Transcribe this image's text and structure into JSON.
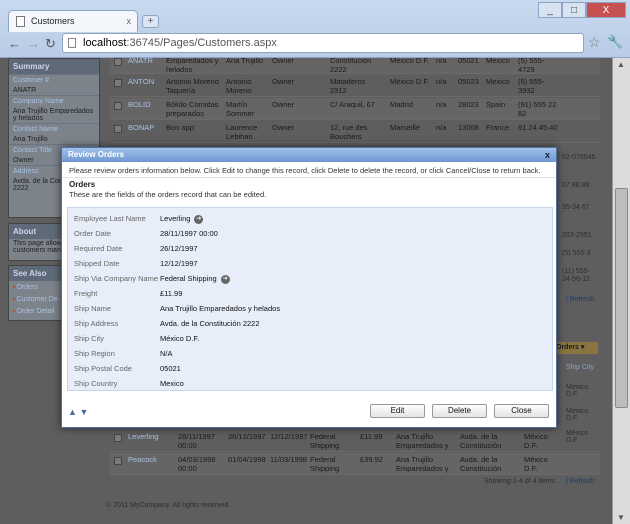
{
  "browser": {
    "tab_title": "Customers",
    "tab_close": "x",
    "new_tab": "+",
    "url_host": "localhost",
    "url_rest": ":36745/Pages/Customers.aspx",
    "win_min": "_",
    "win_max": "□",
    "win_close": "X"
  },
  "sidebar": {
    "summary_header": "Summary",
    "fields": [
      {
        "label": "Customer #",
        "value": "ANATR"
      },
      {
        "label": "Company Name",
        "value": "Ana Trujillo Emparedados y helados"
      },
      {
        "label": "Contact Name",
        "value": "Ana Trujillo"
      },
      {
        "label": "Contact Title",
        "value": "Owner"
      },
      {
        "label": "Address",
        "value": "Avda. de la Constitución 2222"
      }
    ],
    "about_header": "About",
    "about_text": "This page allows customers man",
    "see_also_header": "See Also",
    "links": [
      "Orders",
      "Customer De",
      "Order Detail"
    ]
  },
  "grid_rows": [
    [
      "ANATR",
      "Emparedados y helados",
      "Ana Trujillo",
      "Owner",
      "Constitución 2222",
      "México D.F.",
      "n/a",
      "05021",
      "Mexico",
      "(5) 555-4729"
    ],
    [
      "ANTON",
      "Antonio Moreno Taquería",
      "Antonio Moreno",
      "Owner",
      "Mataderos 2312",
      "México D.F.",
      "n/a",
      "05023",
      "Mexico",
      "(5) 555-3932"
    ],
    [
      "BOLID",
      "Bólido Comidas preparadas",
      "Martín Sommer",
      "Owner",
      "C/ Araquil, 67",
      "Madrid",
      "n/a",
      "28023",
      "Spain",
      "(91) 555 22 82"
    ],
    [
      "BONAP",
      "Bon app'",
      "Laurence Lebihan",
      "Owner",
      "12, rue des Bouchers",
      "Marseille",
      "n/a",
      "13008",
      "France",
      "91.24.45.40"
    ]
  ],
  "right_fragments": [
    "52-076545",
    "67.88.88",
    "95-34 67",
    "283-2951",
    "(5) 555-3",
    "(11) 555-",
    "34-56-12",
    "| Refresh"
  ],
  "orders_grid": {
    "orders_tab": "Orders",
    "ship_city_header": "Ship City",
    "right_cities": [
      "México D.F.",
      "México D.F.",
      "México D.F."
    ],
    "rows": [
      [
        "Leverling",
        "28/11/1997 00:00",
        "26/12/1997",
        "12/12/1997",
        "Federal Shipping",
        "£11.99",
        "Ana Trujillo Emparedados y helados",
        "Avda. de la Constitución 2222",
        "México D.F."
      ],
      [
        "Peacock",
        "04/03/1998 00:00",
        "01/04/1998",
        "11/03/1998",
        "Federal Shipping",
        "£39.92",
        "Ana Trujillo Emparedados y helados",
        "Avda. de la Constitución 2222",
        "México D.F."
      ]
    ],
    "paging": "Showing 1-4 of 4 items",
    "refresh": "| Refresh"
  },
  "copyright": "© 2011 MyCompany. All rights reserved.",
  "modal": {
    "title": "Review Orders",
    "close": "x",
    "instructions": "Please review orders information below. Click Edit to change this record, click Delete to delete the record, or click Cancel/Close to return back.",
    "section_title": "Orders",
    "section_desc": "These are the fields of the orders record that can be edited.",
    "fields": [
      {
        "label": "Employee Last Name",
        "value": "Leverling"
      },
      {
        "label": "Order Date",
        "value": "28/11/1997 00:00"
      },
      {
        "label": "Required Date",
        "value": "26/12/1997"
      },
      {
        "label": "Shipped Date",
        "value": "12/12/1997"
      },
      {
        "label": "Ship Via Company Name",
        "value": "Federal Shipping"
      },
      {
        "label": "Freight",
        "value": "£11.99"
      },
      {
        "label": "Ship Name",
        "value": "Ana Trujillo Emparedados y helados"
      },
      {
        "label": "Ship Address",
        "value": "Avda. de la Constitución 2222"
      },
      {
        "label": "Ship City",
        "value": "México D.F."
      },
      {
        "label": "Ship Region",
        "value": "N/A"
      },
      {
        "label": "Ship Postal Code",
        "value": "05021"
      },
      {
        "label": "Ship Country",
        "value": "Mexico"
      }
    ],
    "edit": "Edit",
    "delete": "Delete",
    "close_button": "Close"
  }
}
